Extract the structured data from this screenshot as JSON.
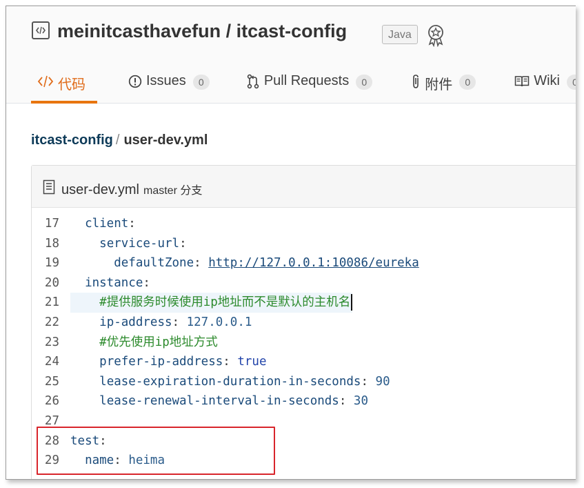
{
  "repo": {
    "owner": "meinitcasthavefun",
    "separator": " / ",
    "name": "itcast-config",
    "language": "Java"
  },
  "tabs": [
    {
      "label": "代码",
      "icon": "code-icon",
      "count": null,
      "active": true
    },
    {
      "label": "Issues",
      "icon": "issue-icon",
      "count": "0",
      "active": false
    },
    {
      "label": "Pull Requests",
      "icon": "pull-request-icon",
      "count": "0",
      "active": false
    },
    {
      "label": "附件",
      "icon": "paperclip-icon",
      "count": "0",
      "active": false
    },
    {
      "label": "Wiki",
      "icon": "book-icon",
      "count": "0",
      "active": false
    }
  ],
  "breadcrumb": {
    "repo": "itcast-config",
    "separator": "/",
    "file": "user-dev.yml"
  },
  "file": {
    "name": "user-dev.yml",
    "branch": "master 分支"
  },
  "code": {
    "lines": [
      {
        "n": "17",
        "indent": "  ",
        "key": "client",
        "sep": ":",
        "value": "",
        "vtype": "none"
      },
      {
        "n": "18",
        "indent": "    ",
        "key": "service-url",
        "sep": ":",
        "value": "",
        "vtype": "none"
      },
      {
        "n": "19",
        "indent": "      ",
        "key": "defaultZone",
        "sep": ": ",
        "value": "http://127.0.0.1:10086/eureka",
        "vtype": "url"
      },
      {
        "n": "20",
        "indent": "  ",
        "key": "instance",
        "sep": ":",
        "value": "",
        "vtype": "none"
      },
      {
        "n": "21",
        "indent": "    ",
        "key": "",
        "sep": "",
        "value": "#提供服务时候使用ip地址而不是默认的主机名",
        "vtype": "comment"
      },
      {
        "n": "22",
        "indent": "    ",
        "key": "ip-address",
        "sep": ": ",
        "value": "127.0.0.1",
        "vtype": "num"
      },
      {
        "n": "23",
        "indent": "    ",
        "key": "",
        "sep": "",
        "value": "#优先使用ip地址方式",
        "vtype": "comment"
      },
      {
        "n": "24",
        "indent": "    ",
        "key": "prefer-ip-address",
        "sep": ": ",
        "value": "true",
        "vtype": "bool"
      },
      {
        "n": "25",
        "indent": "    ",
        "key": "lease-expiration-duration-in-seconds",
        "sep": ": ",
        "value": "90",
        "vtype": "num"
      },
      {
        "n": "26",
        "indent": "    ",
        "key": "lease-renewal-interval-in-seconds",
        "sep": ": ",
        "value": "30",
        "vtype": "num"
      },
      {
        "n": "27",
        "indent": "",
        "key": "",
        "sep": "",
        "value": "",
        "vtype": "none"
      },
      {
        "n": "28",
        "indent": "",
        "key": "test",
        "sep": ":",
        "value": "",
        "vtype": "none"
      },
      {
        "n": "29",
        "indent": "  ",
        "key": "name",
        "sep": ": ",
        "value": "heima",
        "vtype": "num"
      }
    ],
    "highlighted_line": "21"
  },
  "annotation": {
    "box_color": "#d8242b",
    "covers_lines": [
      "28",
      "29"
    ]
  },
  "colors": {
    "accent": "#e8750f",
    "link": "#0d3a58",
    "comment": "#2c8a2c"
  }
}
